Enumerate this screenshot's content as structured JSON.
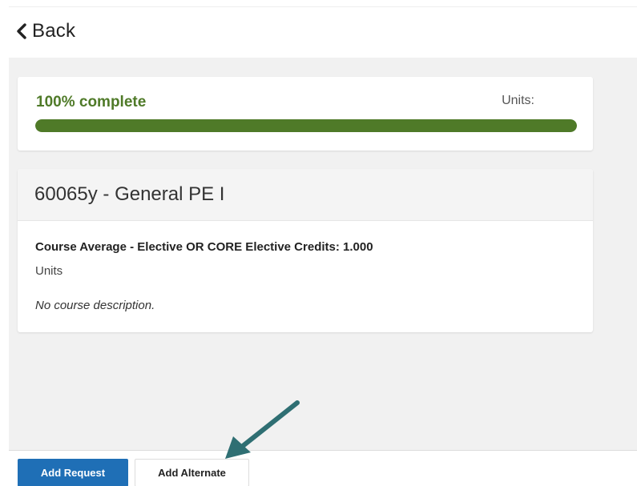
{
  "header": {
    "back_label": "Back",
    "back_icon": "chevron-left-icon"
  },
  "progress": {
    "label": "100% complete",
    "units_label": "Units:",
    "percent": 100,
    "color": "#4f7a28"
  },
  "course": {
    "title": "60065y - General PE I",
    "meta": "Course Average - Elective OR CORE Elective Credits: 1.000",
    "units": "Units",
    "description": "No course description."
  },
  "footer": {
    "add_request_label": "Add Request",
    "add_alternate_label": "Add Alternate",
    "primary_color": "#1f6fb6"
  },
  "annotation": {
    "icon": "pointer-arrow-icon",
    "color": "#2f6f73"
  }
}
